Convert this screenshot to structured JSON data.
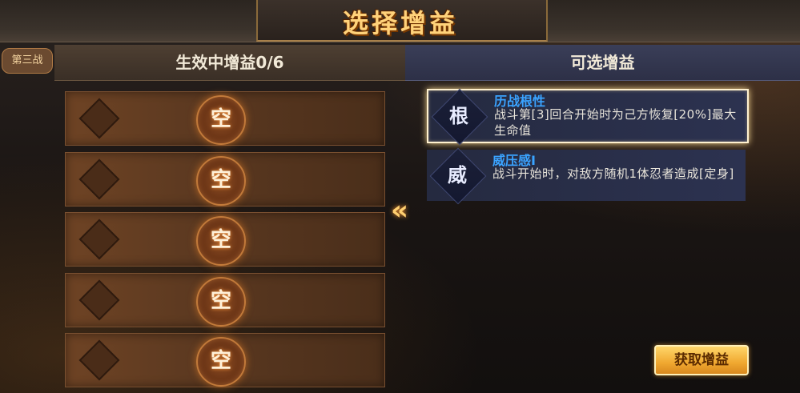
{
  "header": {
    "title": "选择增益",
    "badge": "第三战"
  },
  "left_panel": {
    "title": "生效中增益0/6",
    "slots": [
      {
        "label": "空"
      },
      {
        "label": "空"
      },
      {
        "label": "空"
      },
      {
        "label": "空"
      },
      {
        "label": "空"
      }
    ]
  },
  "right_panel": {
    "title": "可选增益",
    "buffs": [
      {
        "glyph": "根",
        "name": "历战根性",
        "desc": "战斗第[3]回合开始时为己方恢复[20%]最大生命值",
        "selected": true
      },
      {
        "glyph": "威",
        "name": "威压感Ⅰ",
        "desc": "战斗开始时，对敌方随机1体忍者造成[定身]",
        "selected": false
      }
    ]
  },
  "actions": {
    "get_buff_label": "获取增益",
    "transfer_icon": "double-chevron-left-icon"
  },
  "colors": {
    "accent_gold": "#ffd27a",
    "buff_name_blue": "#3aa3ff",
    "button_orange": "#f0a830"
  }
}
